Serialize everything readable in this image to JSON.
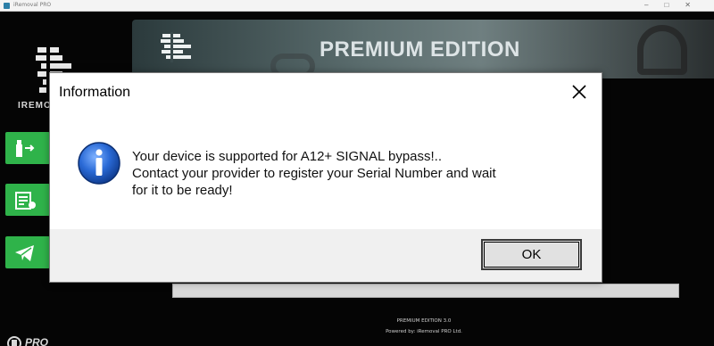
{
  "window": {
    "title": "iRemoval PRO",
    "controls": [
      "–",
      "□",
      "✕"
    ]
  },
  "sidebar": {
    "logo_text": "IREMOVAL",
    "buttons": [
      {
        "icon": "usb-device-icon"
      },
      {
        "icon": "checklist-icon"
      },
      {
        "icon": "telegram-icon"
      }
    ],
    "footer_logo": "PRO"
  },
  "banner": {
    "title": "PREMIUM EDITION"
  },
  "progress": {
    "value": 0
  },
  "footer_info": {
    "line1": "PREMIUM EDITION 3.0",
    "line2": "Powered by: iRemoval PRO Ltd."
  },
  "dialog": {
    "title": "Information",
    "message_lines": [
      "Your device is supported for A12+ SIGNAL bypass!..",
      "Contact your provider to register your Serial Number and wait",
      "for it to be ready!"
    ],
    "ok_label": "OK",
    "icon": "info-icon",
    "accent_color": "#1f5fb8"
  }
}
